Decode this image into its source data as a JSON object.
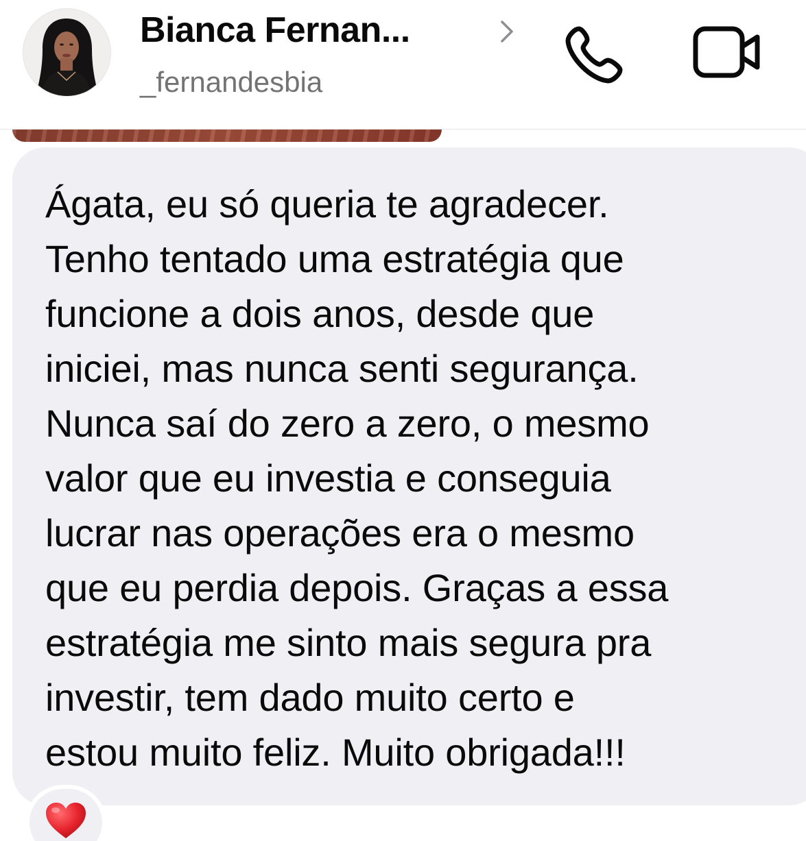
{
  "header": {
    "contact_name": "Bianca Fernan...",
    "username": "_fernandesbia",
    "chevron_icon": "chevron-right-icon",
    "call_icon": "phone-icon",
    "video_icon": "video-camera-icon"
  },
  "message": {
    "text": "Ágata, eu só queria te agradecer.\nTenho tentado uma estratégia que\nfuncione a dois anos, desde que\niniciei, mas nunca senti segurança.\nNunca saí do zero a zero, o mesmo\nvalor que eu investia e conseguia\nlucrar nas operações era o mesmo\nque eu perdia depois. Graças a essa\nestratégia me sinto mais segura pra\ninvestir, tem dado muito certo e\nestou muito feliz. Muito obrigada!!!",
    "reaction": "❤️",
    "reaction_icon": "heart-icon"
  },
  "colors": {
    "bubble": "#efeff4",
    "text": "#0a0a0a",
    "secondary_text": "#737373",
    "heart": "#e8252f"
  }
}
